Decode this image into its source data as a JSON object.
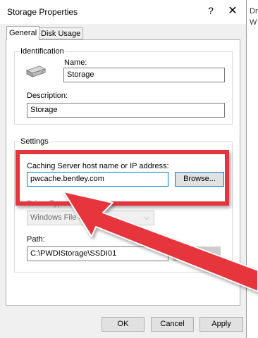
{
  "background_window": {
    "fragment_1": "Dr",
    "fragment_2": "W"
  },
  "dialog": {
    "title": "Storage Properties",
    "help_glyph": "?",
    "close_glyph": "✕",
    "tabs": [
      {
        "label": "General",
        "active": true
      },
      {
        "label": "Disk Usage",
        "active": false
      }
    ],
    "identification": {
      "legend": "Identification",
      "icon": "storage-drive-icon",
      "name_label": "Name:",
      "name_value": "Storage",
      "description_label": "Description:",
      "description_value": "Storage"
    },
    "settings": {
      "legend": "Settings",
      "caching_label": "Caching Server host name or IP address:",
      "caching_value": "pwcache.bentley.com",
      "browse_label": "Browse...",
      "driver_type_label": "Driver Type:",
      "driver_type_value": "Windows File System",
      "path_label": "Path:",
      "path_value": "C:\\PWDIStorage\\SSDI01",
      "path_browse_label": "Browse..."
    },
    "buttons": {
      "ok": "OK",
      "cancel": "Cancel",
      "apply": "Apply"
    }
  },
  "annotation": {
    "highlight_color": "#e6343d"
  }
}
